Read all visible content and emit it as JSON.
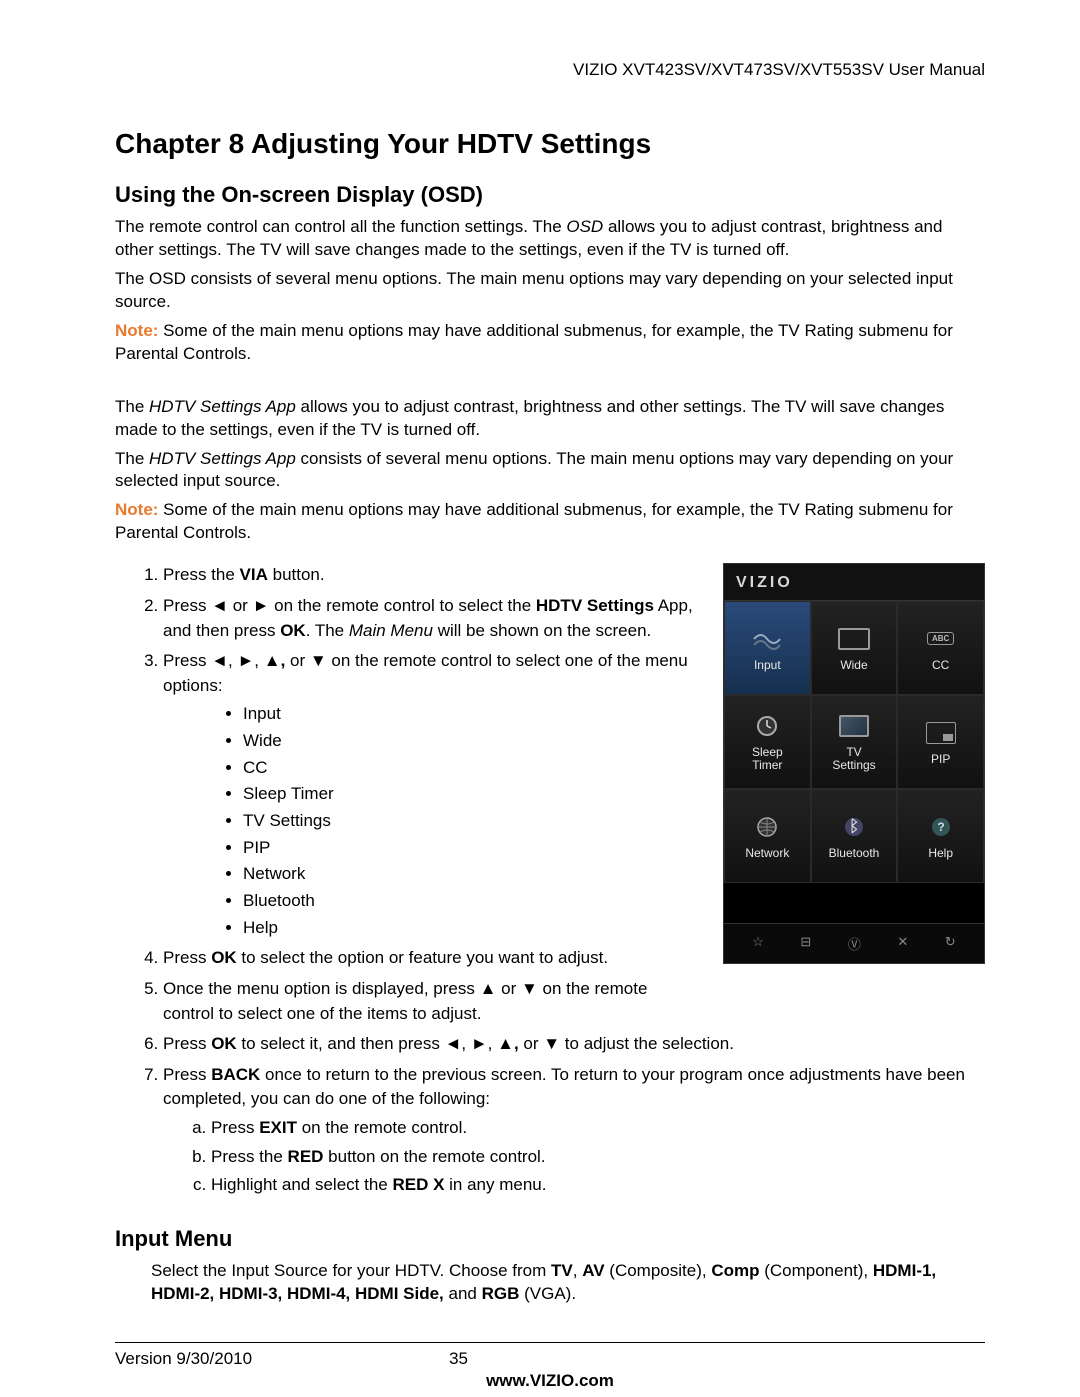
{
  "header": "VIZIO XVT423SV/XVT473SV/XVT553SV User Manual",
  "chapter_title": "Chapter 8 Adjusting Your HDTV Settings",
  "section1_title": "Using the On-screen Display (OSD)",
  "p1_a": "The remote control can control all the function settings. The ",
  "p1_b": "OSD",
  "p1_c": " allows you to adjust contrast, brightness and other settings. The TV will save changes made to the settings, even if the TV is turned off.",
  "p2": "The OSD consists of several menu options. The main menu options may vary depending on your selected input source.",
  "note_label": "Note:",
  "note1_rest": "  Some of the main menu options may have additional submenus, for example, the TV Rating submenu for Parental Controls.",
  "p3_a": "The ",
  "p3_b": "HDTV Settings App",
  "p3_c": " allows you to adjust contrast, brightness and other settings. The TV will save changes made to the settings, even if the TV is turned off.",
  "p4_a": "The ",
  "p4_b": "HDTV Settings App",
  "p4_c": " consists of several menu options. The main menu options may vary depending on your selected input source.",
  "note2_rest": "  Some of the main menu options may have additional submenus, for example, the TV Rating submenu for Parental Controls.",
  "steps": {
    "s1_a": "Press the ",
    "s1_b": "VIA",
    "s1_c": " button.",
    "s2_a": "Press ◄ or ► on the remote control to select the ",
    "s2_b": "HDTV Settings",
    "s2_c": " App, and then press ",
    "s2_d": "OK",
    "s2_e": ". The ",
    "s2_f": "Main Menu",
    "s2_g": " will be shown on the screen.",
    "s3_a": "Press ◄, ►, ▲",
    "s3_b": ",",
    "s3_c": " or ▼ on the remote control to select one of the menu options:",
    "opts": [
      "Input",
      "Wide",
      "CC",
      "Sleep Timer",
      "TV Settings",
      "PIP",
      "Network",
      "Bluetooth",
      "Help"
    ],
    "s4_a": "Press ",
    "s4_b": "OK",
    "s4_c": " to select the option or feature you want to adjust.",
    "s5": "Once the menu option is displayed, press ▲ or ▼ on the remote control to select one of the items to adjust.",
    "s6_a": "Press ",
    "s6_b": "OK",
    "s6_c": " to select it, and then press ◄, ►, ▲",
    "s6_d": ",",
    "s6_e": " or ▼ to adjust the selection.",
    "s7_a": "Press ",
    "s7_b": "BACK",
    "s7_c": " once to return to the previous screen. To return to your program once adjustments have been completed, you can do one of the following:",
    "sub_a_a": "Press ",
    "sub_a_b": "EXIT",
    "sub_a_c": " on the remote control.",
    "sub_b_a": "Press the ",
    "sub_b_b": "RED",
    "sub_b_c": " button on the remote control.",
    "sub_c_a": "Highlight and select the ",
    "sub_c_b": "RED X",
    "sub_c_c": " in any menu."
  },
  "osd": {
    "brand": "VIZIO",
    "cells": [
      {
        "label": "Input"
      },
      {
        "label": "Wide"
      },
      {
        "label": "CC"
      },
      {
        "label": "Sleep\nTimer"
      },
      {
        "label": "TV\nSettings"
      },
      {
        "label": "PIP"
      },
      {
        "label": "Network"
      },
      {
        "label": "Bluetooth"
      },
      {
        "label": "Help"
      }
    ],
    "bottom": [
      "☆",
      "⊟",
      "Ⓥ",
      "✕",
      "↻"
    ]
  },
  "section2_title": "Input Menu",
  "input_menu_a": "Select the Input Source for your HDTV. Choose from ",
  "input_menu_b": "TV",
  "input_menu_c": ", ",
  "input_menu_d": "AV",
  "input_menu_e": " (Composite), ",
  "input_menu_f": "Comp",
  "input_menu_g": " (Component), ",
  "input_menu_h": "HDMI-1, HDMI-2, HDMI-3, HDMI-4, HDMI Side,",
  "input_menu_i": " and ",
  "input_menu_j": "RGB",
  "input_menu_k": " (VGA).",
  "footer_version": "Version 9/30/2010",
  "footer_page": "35",
  "footer_url": "www.VIZIO.com"
}
